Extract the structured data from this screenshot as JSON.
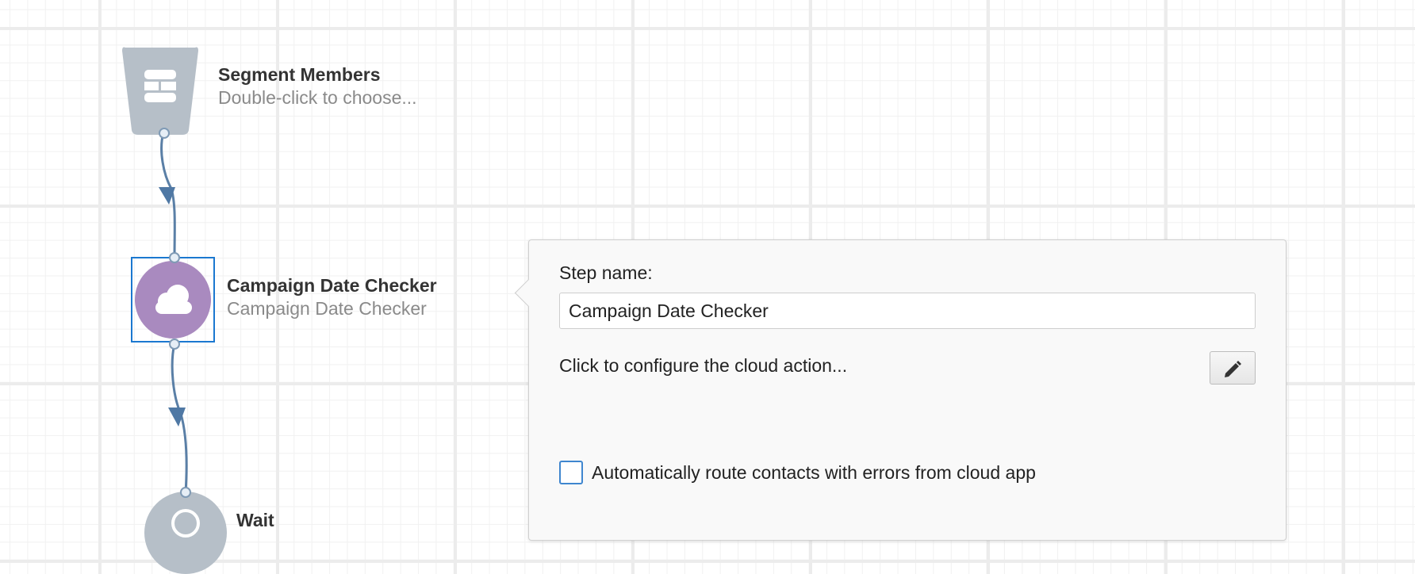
{
  "nodes": [
    {
      "title": "Segment Members",
      "subtitle": "Double-click to choose..."
    },
    {
      "title": "Campaign Date Checker",
      "subtitle": "Campaign Date Checker"
    },
    {
      "title": "Wait",
      "subtitle": ""
    }
  ],
  "panel": {
    "step_name_label": "Step name:",
    "step_name_value": "Campaign Date Checker",
    "configure_text": "Click to configure the cloud action...",
    "auto_route_label": "Automatically route contacts with errors from cloud app",
    "auto_route_checked": false
  },
  "colors": {
    "segment_node": "#b6bfc8",
    "cloud_node": "#a98abf",
    "wait_node": "#b6bfc8",
    "selection_border": "#1b78d0",
    "connector": "#5a7fa6"
  },
  "icons": {
    "segment": "segment-stack-icon",
    "cloud_action": "cloud-icon",
    "edit": "pencil-icon",
    "wait": "clock-icon"
  }
}
